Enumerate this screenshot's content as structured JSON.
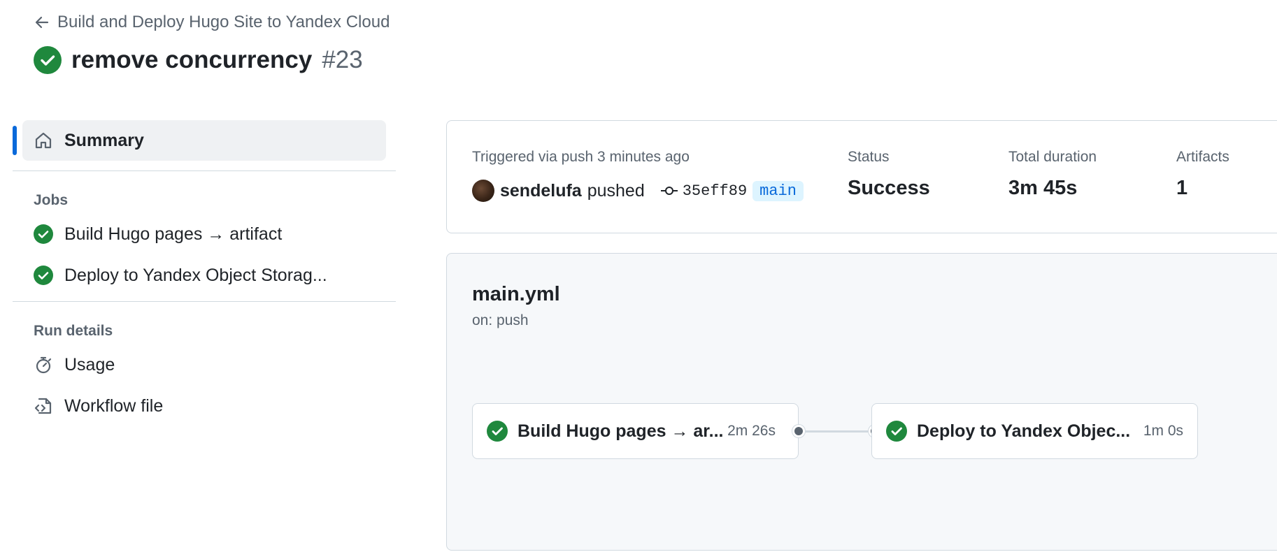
{
  "header": {
    "back_label": "Build and Deploy Hugo Site to Yandex Cloud",
    "run_title": "remove concurrency",
    "run_number": "#23"
  },
  "sidebar": {
    "summary_label": "Summary",
    "jobs_heading": "Jobs",
    "jobs": [
      {
        "label": "Build Hugo pages → artifact"
      },
      {
        "label": "Deploy to Yandex Object Storag..."
      }
    ],
    "run_details_heading": "Run details",
    "details": [
      {
        "label": "Usage",
        "icon": "stopwatch-icon"
      },
      {
        "label": "Workflow file",
        "icon": "file-code-icon"
      }
    ]
  },
  "summary": {
    "trigger_text": "Triggered via push 3 minutes ago",
    "user": "sendelufa",
    "action": "pushed",
    "commit": "35eff89",
    "branch": "main",
    "status_label": "Status",
    "status_value": "Success",
    "duration_label": "Total duration",
    "duration_value": "3m 45s",
    "artifacts_label": "Artifacts",
    "artifacts_value": "1"
  },
  "workflow": {
    "file": "main.yml",
    "trigger": "on: push",
    "jobs": [
      {
        "name": "Build Hugo pages → ar...",
        "duration": "2m 26s",
        "status": "success"
      },
      {
        "name": "Deploy to Yandex Objec...",
        "duration": "1m 0s",
        "status": "success"
      }
    ]
  },
  "colors": {
    "success": "#1f883d",
    "accent": "#0969da",
    "muted_text": "#59636e",
    "border": "#d1d9e0"
  }
}
